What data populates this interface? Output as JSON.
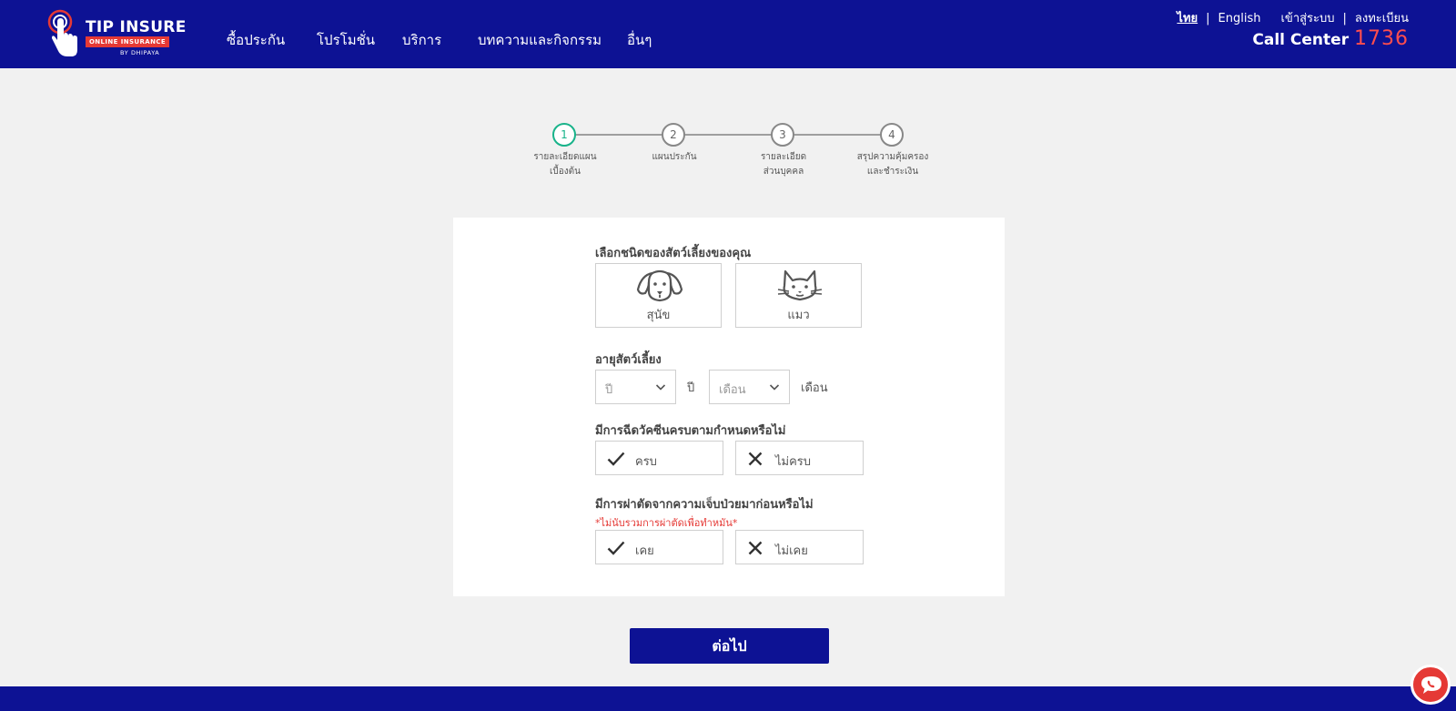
{
  "header": {
    "logo": {
      "brand": "TIP INSURE",
      "tagline": "ONLINE INSURANCE",
      "byline": "BY DHIPAYA"
    },
    "nav": [
      {
        "label": "ซื้อประกัน"
      },
      {
        "label": "โปรโมชั่น"
      },
      {
        "label": "บริการ"
      },
      {
        "label": "บทความและกิจกรรม"
      },
      {
        "label": "อื่นๆ"
      }
    ],
    "lang_th": "ไทย",
    "lang_sep": "|",
    "lang_en": "English",
    "login": "เข้าสู่ระบบ",
    "auth_sep": "|",
    "register": "ลงทะเบียน",
    "callcenter_label": "Call Center",
    "callcenter_number": "1736"
  },
  "stepper": {
    "current_step": 1,
    "steps": [
      {
        "num": "1",
        "label": "รายละเอียดแผน\nเบื้องต้น"
      },
      {
        "num": "2",
        "label": "แผนประกัน"
      },
      {
        "num": "3",
        "label": "รายละเอียด\nส่วนบุคคล"
      },
      {
        "num": "4",
        "label": "สรุปความคุ้มครอง\nและชำระเงิน"
      }
    ]
  },
  "form": {
    "pet_type": {
      "label": "เลือกชนิดของสัตว์เลี้ยงของคุณ",
      "options": [
        {
          "label": "สุนัข",
          "icon": "dog-icon"
        },
        {
          "label": "แมว",
          "icon": "cat-icon"
        }
      ]
    },
    "pet_age": {
      "label": "อายุสัตว์เลี้ยง",
      "year_placeholder": "ปี",
      "year_unit": "ปี",
      "month_placeholder": "เดือน",
      "month_unit": "เดือน"
    },
    "vaccine": {
      "label": "มีการฉีดวัคซีนครบตามกำหนดหรือไม่",
      "yes": "ครบ",
      "no": "ไม่ครบ"
    },
    "surgery": {
      "label": "มีการผ่าตัดจากความเจ็บป่วยมาก่อนหรือไม่",
      "note": "*ไม่นับรวมการผ่าตัดเพื่อทำหมัน*",
      "yes": "เคย",
      "no": "ไม่เคย"
    }
  },
  "next_button": "ต่อไป",
  "colors": {
    "brand_navy": "#0d1294",
    "accent_red": "#e53935",
    "step_active": "#19b38a"
  }
}
